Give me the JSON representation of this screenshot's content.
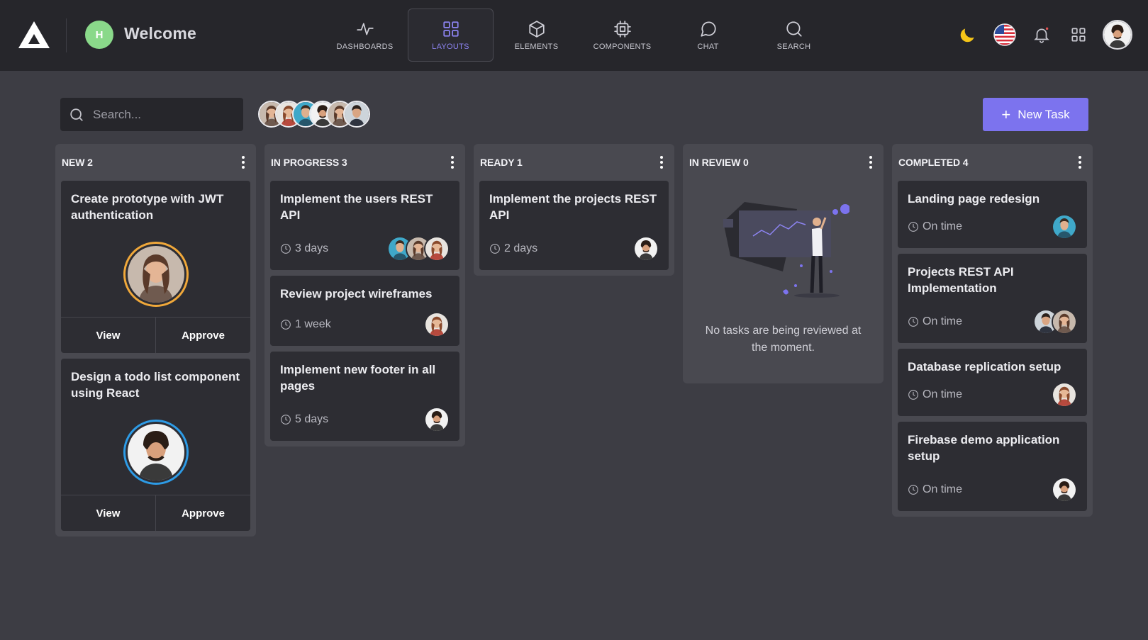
{
  "header": {
    "user_initial": "H",
    "welcome": "Welcome",
    "nav": [
      {
        "label": "DASHBOARDS",
        "icon": "activity-icon"
      },
      {
        "label": "LAYOUTS",
        "icon": "grid-icon",
        "active": true
      },
      {
        "label": "ELEMENTS",
        "icon": "box-icon"
      },
      {
        "label": "COMPONENTS",
        "icon": "cpu-icon"
      },
      {
        "label": "CHAT",
        "icon": "chat-bubble-icon"
      },
      {
        "label": "SEARCH",
        "icon": "search-icon"
      }
    ]
  },
  "toolbar": {
    "search_placeholder": "Search...",
    "new_task_label": "New Task"
  },
  "columns": [
    {
      "title": "NEW 2"
    },
    {
      "title": "IN PROGRESS 3"
    },
    {
      "title": "READY 1"
    },
    {
      "title": "IN REVIEW 0"
    },
    {
      "title": "COMPLETED 4"
    }
  ],
  "cards": {
    "new": [
      {
        "title": "Create prototype with JWT authentication",
        "view": "View",
        "approve": "Approve"
      },
      {
        "title": "Design a todo list component using React",
        "view": "View",
        "approve": "Approve"
      }
    ],
    "in_progress": [
      {
        "title": "Implement the users REST API",
        "due": "3 days"
      },
      {
        "title": "Review project wireframes",
        "due": "1 week"
      },
      {
        "title": "Implement new footer in all pages",
        "due": "5 days"
      }
    ],
    "ready": [
      {
        "title": "Implement the projects REST API",
        "due": "2 days"
      }
    ],
    "in_review": {
      "empty_text": "No tasks are being reviewed at the moment."
    },
    "completed": [
      {
        "title": "Landing page redesign",
        "due": "On time"
      },
      {
        "title": "Projects REST API Implementation",
        "due": "On time"
      },
      {
        "title": "Database replication setup",
        "due": "On time"
      },
      {
        "title": "Firebase demo application setup",
        "due": "On time"
      }
    ]
  },
  "colors": {
    "accent": "#7c73ee",
    "nav_active": "#8d84f2",
    "background": "#3d3d44",
    "column": "#494950",
    "card": "#2d2d33",
    "avatar_ring_orange": "#f0a83a",
    "avatar_ring_blue": "#2d9be6"
  }
}
